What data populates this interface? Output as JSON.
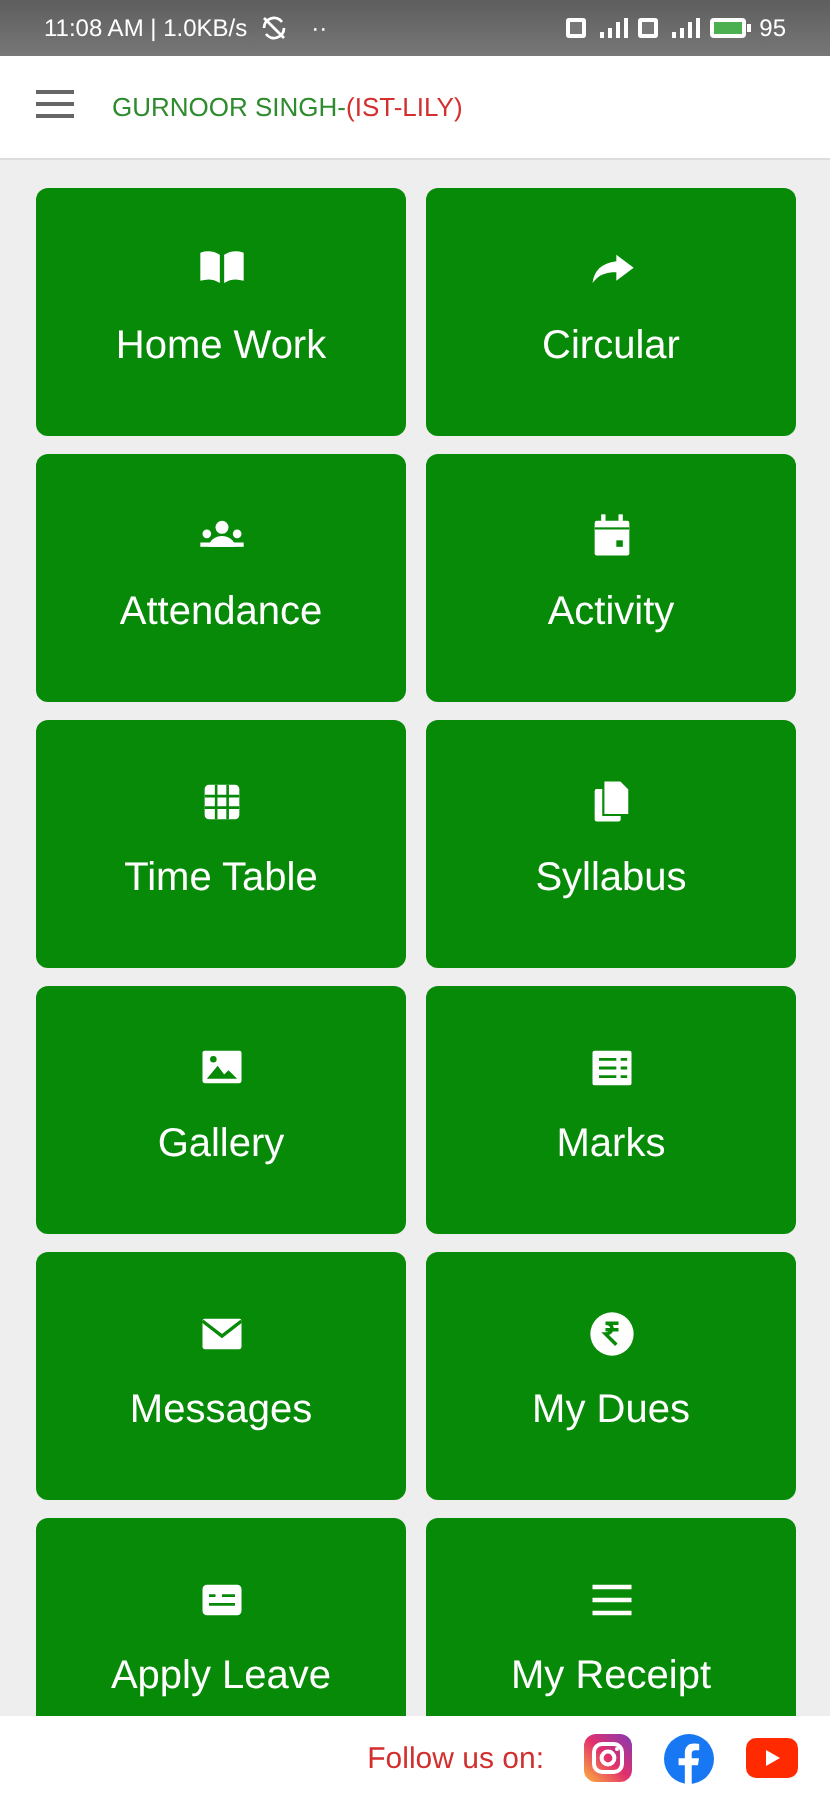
{
  "status_bar": {
    "time": "11:08 AM | 1.0KB/s",
    "more": "··",
    "battery": "95"
  },
  "app_bar": {
    "title": "GURNOOR SINGH-",
    "class_section": "(IST-LILY)"
  },
  "tiles": [
    {
      "label": "Home Work"
    },
    {
      "label": "Circular"
    },
    {
      "label": "Attendance"
    },
    {
      "label": "Activity"
    },
    {
      "label": "Time Table"
    },
    {
      "label": "Syllabus"
    },
    {
      "label": "Gallery"
    },
    {
      "label": "Marks"
    },
    {
      "label": "Messages"
    },
    {
      "label": "My Dues"
    },
    {
      "label": "Apply Leave"
    },
    {
      "label": "My Receipt"
    }
  ],
  "footer": {
    "label": "Follow us on:"
  }
}
